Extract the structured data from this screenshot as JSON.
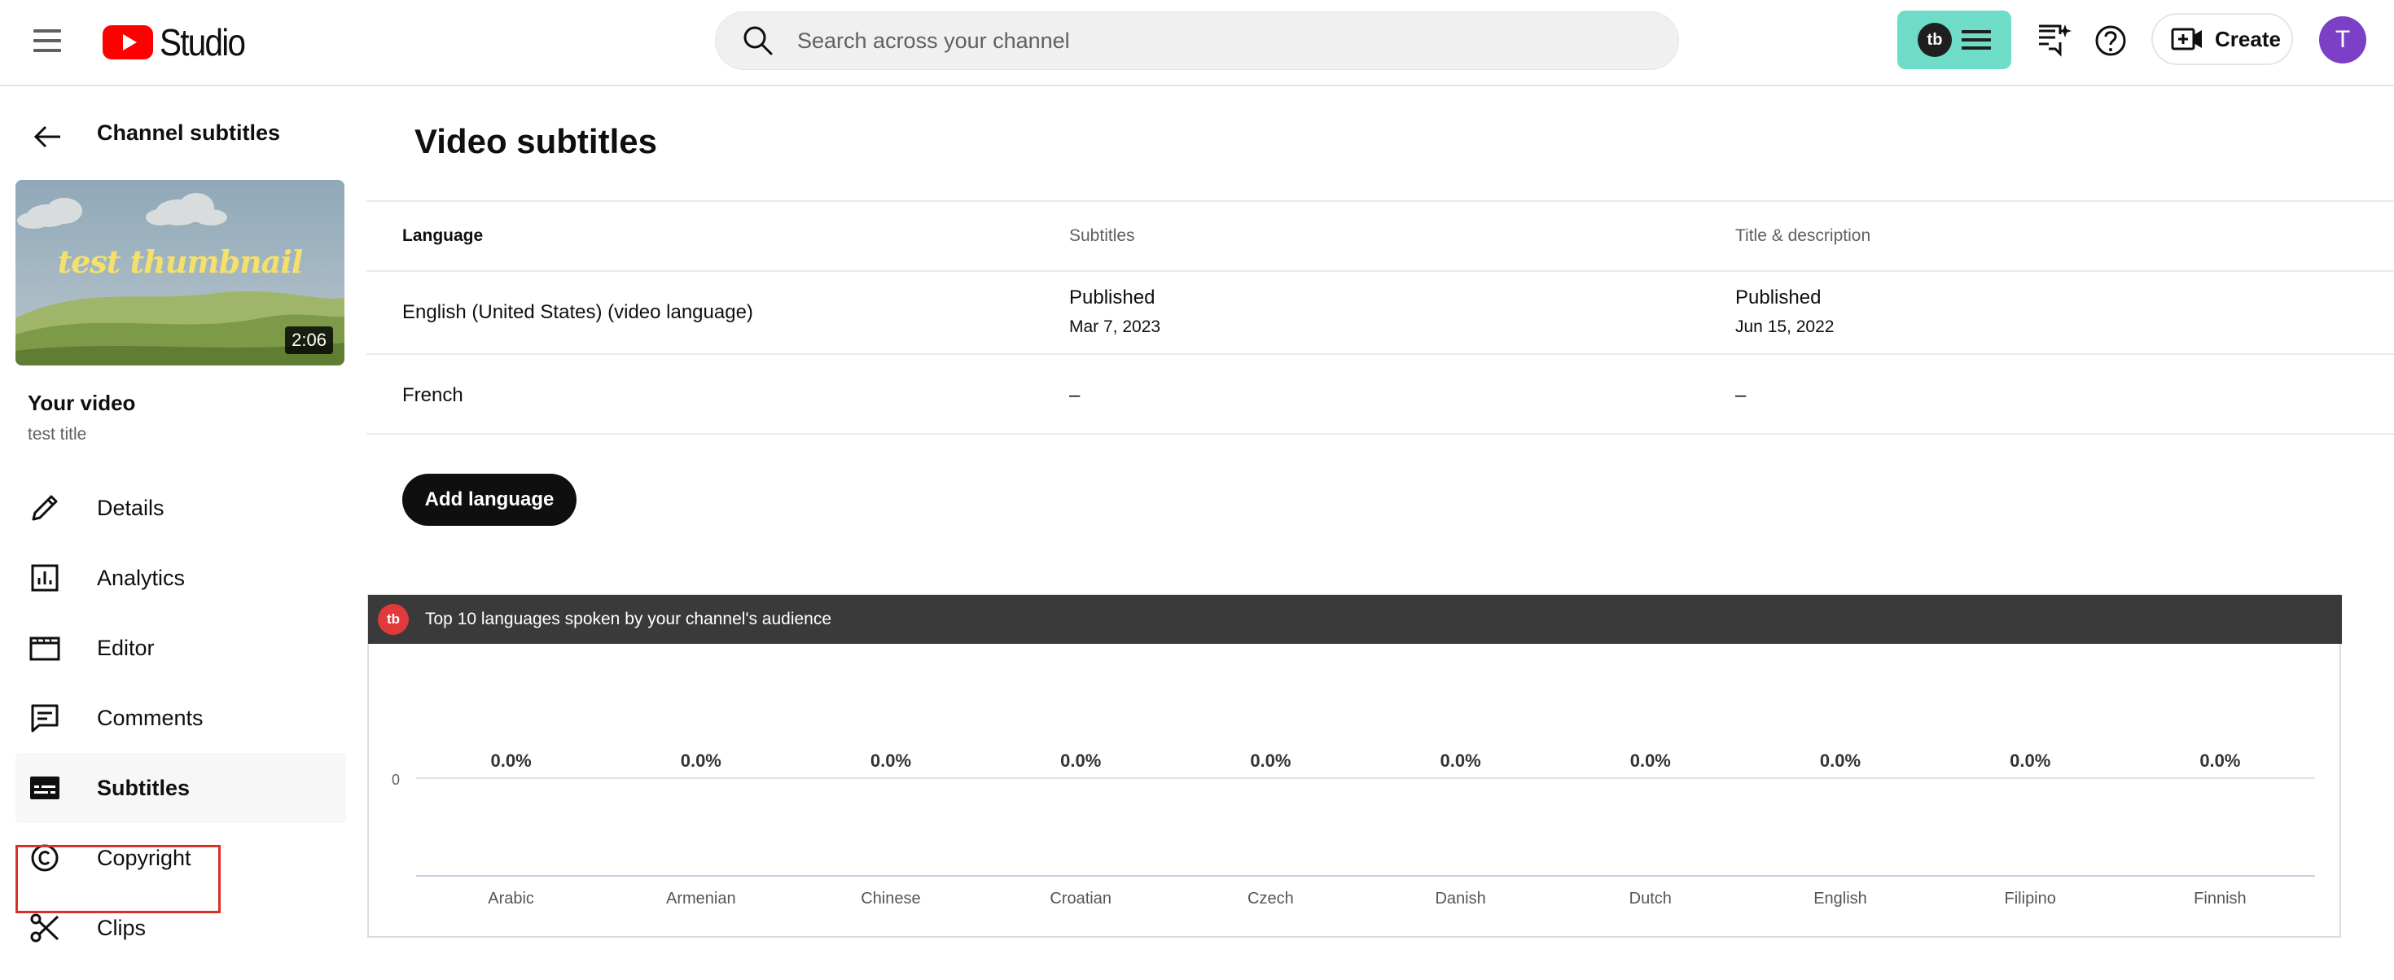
{
  "header": {
    "logo_text": "Studio",
    "search_placeholder": "Search across your channel",
    "tb_badge": "tb",
    "create_label": "Create",
    "avatar_letter": "T"
  },
  "sidebar": {
    "back_title": "Channel subtitles",
    "thumbnail_text": "test thumbnail",
    "duration": "2:06",
    "your_video": "Your video",
    "video_title": "test title",
    "items": [
      {
        "label": "Details",
        "icon": "pencil-icon"
      },
      {
        "label": "Analytics",
        "icon": "analytics-icon"
      },
      {
        "label": "Editor",
        "icon": "editor-icon"
      },
      {
        "label": "Comments",
        "icon": "comments-icon"
      },
      {
        "label": "Subtitles",
        "icon": "subtitles-icon",
        "active": true
      },
      {
        "label": "Copyright",
        "icon": "copyright-icon"
      },
      {
        "label": "Clips",
        "icon": "scissors-icon"
      }
    ]
  },
  "main": {
    "title": "Video subtitles",
    "columns": [
      "Language",
      "Subtitles",
      "Title & description"
    ],
    "rows": [
      {
        "language": "English (United States) (video language)",
        "subtitles_status": "Published",
        "subtitles_date": "Mar 7, 2023",
        "title_status": "Published",
        "title_date": "Jun 15, 2022"
      },
      {
        "language": "French",
        "subtitles_status": "–",
        "title_status": "–"
      }
    ],
    "add_language_label": "Add language"
  },
  "panel": {
    "logo": "tb",
    "title": "Top 10 languages spoken by your channel's audience"
  },
  "chart_data": {
    "type": "bar",
    "title": "Top 10 languages spoken by your channel's audience",
    "categories": [
      "Arabic",
      "Armenian",
      "Chinese",
      "Croatian",
      "Czech",
      "Danish",
      "Dutch",
      "English",
      "Filipino",
      "Finnish"
    ],
    "values": [
      0,
      0,
      0,
      0,
      0,
      0,
      0,
      0,
      0,
      0
    ],
    "data_labels": [
      "0.0%",
      "0.0%",
      "0.0%",
      "0.0%",
      "0.0%",
      "0.0%",
      "0.0%",
      "0.0%",
      "0.0%",
      "0.0%"
    ],
    "y_ticks": [
      "0"
    ],
    "xlabel": "",
    "ylabel": ""
  },
  "colors": {
    "accent_teal": "#6fdcc8",
    "youtube_red": "#ff0000",
    "avatar_purple": "#7b40c6",
    "highlight_red": "#d93025",
    "panel_header": "#3a3a3a"
  }
}
